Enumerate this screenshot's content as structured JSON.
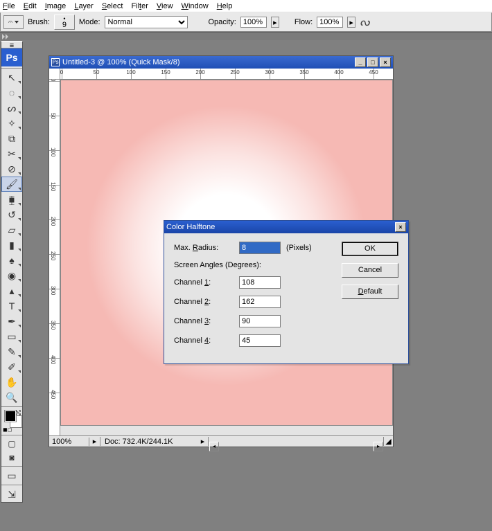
{
  "menu": {
    "file": "File",
    "edit": "Edit",
    "image": "Image",
    "layer": "Layer",
    "select": "Select",
    "filter": "Filter",
    "view": "View",
    "window": "Window",
    "help": "Help"
  },
  "options": {
    "brush_label": "Brush:",
    "brush_size": "9",
    "mode_label": "Mode:",
    "mode_value": "Normal",
    "opacity_label": "Opacity:",
    "opacity_value": "100%",
    "flow_label": "Flow:",
    "flow_value": "100%"
  },
  "document": {
    "title": "Untitled-3 @ 100% (Quick Mask/8)",
    "zoom": "100%",
    "docinfo": "Doc: 732.4K/244.1K",
    "ruler_ticks": [
      "0",
      "50",
      "100",
      "150",
      "200",
      "250",
      "300",
      "350",
      "400",
      "450"
    ]
  },
  "dialog": {
    "title": "Color Halftone",
    "max_radius_label": "Max. Radius:",
    "max_radius_value": "8",
    "pixels_label": "(Pixels)",
    "screen_angles_label": "Screen Angles (Degrees):",
    "ch1_label": "Channel 1:",
    "ch1_value": "108",
    "ch2_label": "Channel 2:",
    "ch2_value": "162",
    "ch3_label": "Channel 3:",
    "ch3_value": "90",
    "ch4_label": "Channel 4:",
    "ch4_value": "45",
    "ok": "OK",
    "cancel": "Cancel",
    "default": "Default"
  },
  "tools": [
    "move",
    "marquee",
    "lasso",
    "wand",
    "crop",
    "slice",
    "healing",
    "brush",
    "stamp",
    "history-brush",
    "eraser",
    "gradient",
    "blur",
    "dodge",
    "path-select",
    "type",
    "pen",
    "shape",
    "notes",
    "eyedropper",
    "hand",
    "zoom"
  ]
}
